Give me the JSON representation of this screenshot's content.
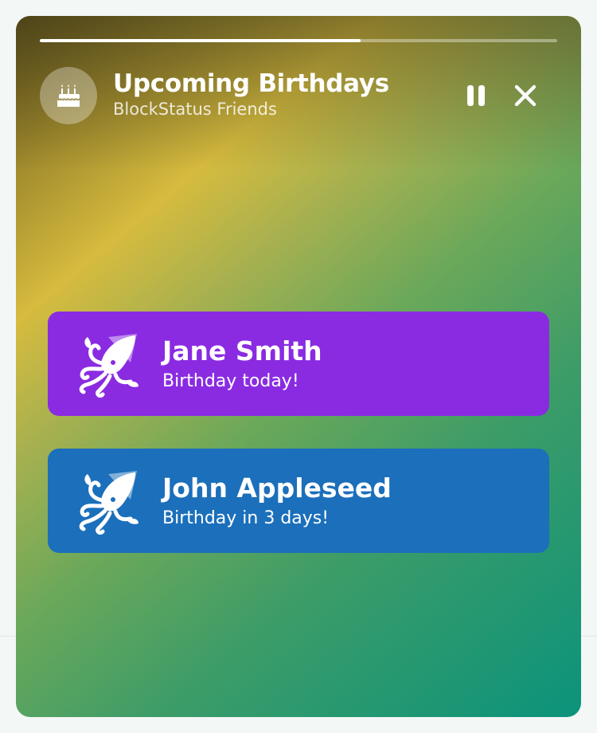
{
  "story": {
    "progress": 0.62,
    "avatar_icon": "birthday-cake-icon",
    "title": "Upcoming Birthdays",
    "subtitle": "BlockStatus Friends",
    "controls": {
      "pause_icon": "pause-icon",
      "close_icon": "close-icon"
    }
  },
  "birthdays": [
    {
      "name": "Jane Smith",
      "detail": "Birthday today!",
      "icon": "squid-icon",
      "color": "#8a2be2"
    },
    {
      "name": "John Appleseed",
      "detail": "Birthday in 3 days!",
      "icon": "squid-icon",
      "color": "#1b6fbb"
    }
  ]
}
